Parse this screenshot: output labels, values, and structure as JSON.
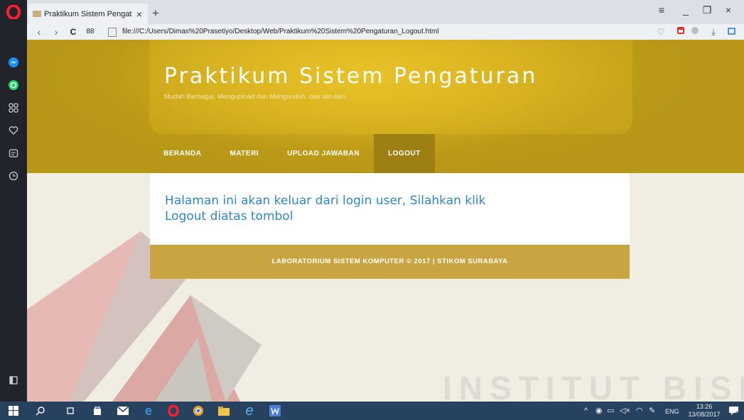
{
  "browser": {
    "tab_title": "Praktikum Sistem Pengatu",
    "tab_close": "×",
    "new_tab": "+",
    "url": "file:///C:/Users/Dimas%20Prasetiyo/Desktop/Web/Praktikum%20Sistem%20Pengaturan_Logout.html",
    "back": "‹",
    "forward": "›",
    "reload": "C",
    "speed_dial": "88",
    "window_controls": {
      "menu": "≡",
      "minimize": "_",
      "restore": "❐",
      "close": "×"
    }
  },
  "site": {
    "title": "Praktikum Sistem Pengaturan",
    "subtitle": "Mudah Berbagai, Mengupload dan Mengunduh, dan lain-lain.",
    "nav": [
      {
        "label": "BERANDA"
      },
      {
        "label": "MATERI"
      },
      {
        "label": "UPLOAD JAWABAN"
      },
      {
        "label": "LOGOUT"
      }
    ],
    "message": "Halaman ini akan keluar dari login user, Silahkan klik Logout diatas tombol",
    "footer": "LABORATORIUM SISTEM KOMPUTER © 2017 | STIKOM SURABAYA"
  },
  "watermark": {
    "text": "INSTITUT BISNIS"
  },
  "taskbar": {
    "tray_lang": "ENG",
    "time": "13:26",
    "date": "13/08/2017",
    "notifications": "2"
  },
  "colors": {
    "header_gold": "#d6b020",
    "nav_active": "#9d7f14",
    "link_blue": "#2f86c8",
    "footer_gold": "#c8a540",
    "taskbar": "#27425e"
  }
}
